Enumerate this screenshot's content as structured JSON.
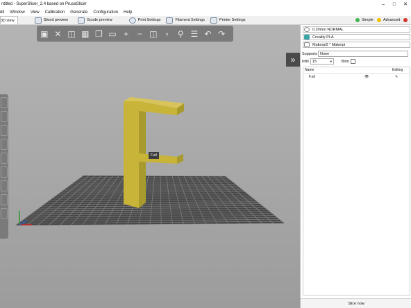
{
  "window": {
    "title": "ntitled - SuperSlicer_2.4 based on PrusaSlicer"
  },
  "menu": [
    "dit",
    "Window",
    "View",
    "Calibration",
    "Generate",
    "Configuration",
    "Help"
  ],
  "tabs": {
    "view3d": "3D view",
    "sliced": "Sliced preview",
    "gcode": "Gcode preview",
    "print": "Print Settings",
    "filament": "Filament Settings",
    "printer": "Printer Settings"
  },
  "modes": {
    "simple": "Simple",
    "advanced": "Advanced"
  },
  "scene": {
    "object_tag": "F.stl"
  },
  "sidebar": {
    "print_preset": "0.20mm NORMAL",
    "filament_preset": "Creality PLA",
    "printer_preset": "Makerpi2 * Makerpi",
    "supports_label": "Supports",
    "supports_value": "None",
    "infill_label": "Infill",
    "infill_value": "15",
    "brim_label": "Brim",
    "col_name": "Name",
    "col_editing": "Editing",
    "object_name": "F.stl",
    "slice_button": "Slice now"
  },
  "colors": {
    "accent_green": "#3fb34f",
    "advanced_yellow": "#f0c000",
    "expert_red": "#d0342c",
    "model_yellow": "#c9b43a"
  }
}
